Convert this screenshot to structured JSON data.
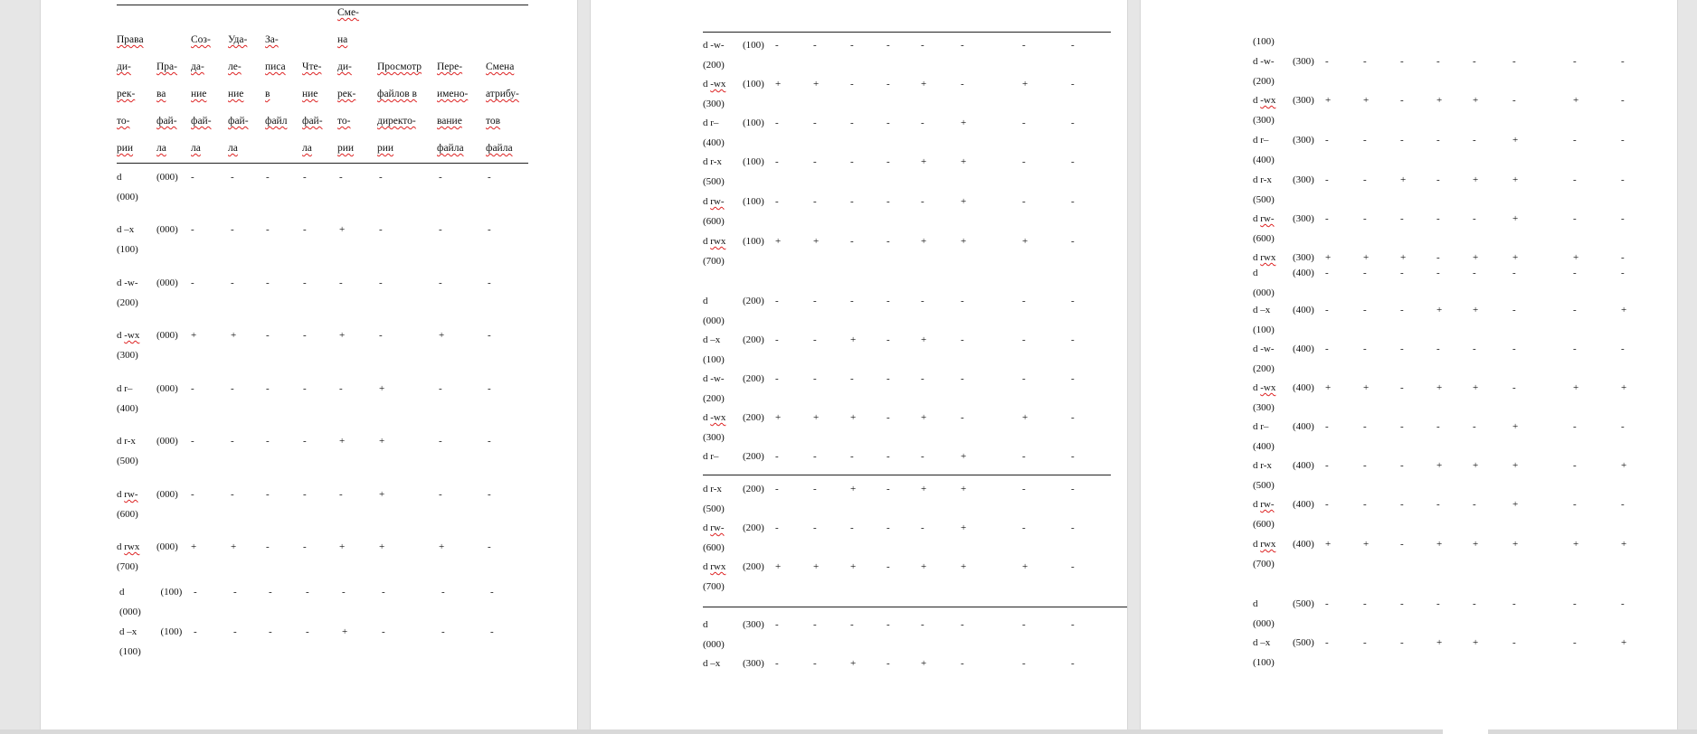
{
  "header": {
    "col1": [
      "Права",
      "ди-",
      "рек-",
      "то-",
      "рии"
    ],
    "col2": [
      "Пра-",
      "ва",
      "фай-",
      "ла"
    ],
    "col3": [
      "Соз-",
      "да-",
      "ние",
      "фай-",
      "ла"
    ],
    "col4": [
      "Уда-",
      "ле-",
      "ние",
      "фай-",
      "ла"
    ],
    "col5": [
      "За-",
      "писа",
      "в",
      "файл"
    ],
    "col6": [
      "Чте-",
      "ние",
      "фай-",
      "ла"
    ],
    "col7": [
      "Сме-",
      "на",
      "ди-",
      "рек-",
      "то-",
      "рии"
    ],
    "col8": [
      "Просмотр",
      "файлов в",
      "директо-",
      "рии"
    ],
    "col9": [
      "Пере-",
      "имено-",
      "вание",
      "файла"
    ],
    "col10": [
      "Смена",
      "атрибу-",
      "тов",
      "файла"
    ]
  },
  "page1_rows": [
    {
      "d": "d",
      "oct": "(000)",
      "file": "(000)",
      "v": [
        "-",
        "-",
        "-",
        "-",
        "-",
        "-",
        "-",
        "-"
      ]
    },
    {
      "d": "d –x",
      "oct": "(100)",
      "file": "(000)",
      "v": [
        "-",
        "-",
        "-",
        "-",
        "+",
        "-",
        "-",
        "-"
      ]
    },
    {
      "d": "d -w-",
      "oct": "(200)",
      "file": "(000)",
      "v": [
        "-",
        "-",
        "-",
        "-",
        "-",
        "-",
        "-",
        "-"
      ]
    },
    {
      "d": "d -wx",
      "oct": "(300)",
      "file": "(000)",
      "v": [
        "+",
        "+",
        "-",
        "-",
        "+",
        "-",
        "+",
        "-"
      ]
    },
    {
      "d": "d r–",
      "oct": "(400)",
      "file": "(000)",
      "v": [
        "-",
        "-",
        "-",
        "-",
        "-",
        "+",
        "-",
        "-"
      ]
    },
    {
      "d": "d r-x",
      "oct": "(500)",
      "file": "(000)",
      "v": [
        "-",
        "-",
        "-",
        "-",
        "+",
        "+",
        "-",
        "-"
      ]
    },
    {
      "d": "d rw-",
      "oct": "(600)",
      "file": "(000)",
      "v": [
        "-",
        "-",
        "-",
        "-",
        "-",
        "+",
        "-",
        "-"
      ]
    },
    {
      "d": "d rwx",
      "oct": "(700)",
      "file": "(000)",
      "v": [
        "+",
        "+",
        "-",
        "-",
        "+",
        "+",
        "+",
        "-"
      ]
    },
    {
      "d": "d",
      "oct": "(000)",
      "file": "(100)",
      "v": [
        "-",
        "-",
        "-",
        "-",
        "-",
        "-",
        "-",
        "-"
      ]
    },
    {
      "d": "d –x",
      "oct": "(100)",
      "file": "(100)",
      "v": [
        "-",
        "-",
        "-",
        "-",
        "+",
        "-",
        "-",
        "-"
      ]
    }
  ],
  "page2_rows": [
    {
      "d": "d -w-",
      "oct": "(200)",
      "file": "(100)",
      "v": [
        "-",
        "-",
        "-",
        "-",
        "-",
        "-",
        "-",
        "-"
      ]
    },
    {
      "d": "d -wx",
      "oct": "(300)",
      "file": "(100)",
      "v": [
        "+",
        "+",
        "-",
        "-",
        "+",
        "-",
        "+",
        "-"
      ]
    },
    {
      "d": "d r–",
      "oct": "(400)",
      "file": "(100)",
      "v": [
        "-",
        "-",
        "-",
        "-",
        "-",
        "+",
        "-",
        "-"
      ]
    },
    {
      "d": "d r-x",
      "oct": "(500)",
      "file": "(100)",
      "v": [
        "-",
        "-",
        "-",
        "-",
        "+",
        "+",
        "-",
        "-"
      ]
    },
    {
      "d": "d rw-",
      "oct": "(600)",
      "file": "(100)",
      "v": [
        "-",
        "-",
        "-",
        "-",
        "-",
        "+",
        "-",
        "-"
      ]
    },
    {
      "d": "d rwx",
      "oct": "(700)",
      "file": "(100)",
      "v": [
        "+",
        "+",
        "-",
        "-",
        "+",
        "+",
        "+",
        "-"
      ]
    },
    {
      "d": "d",
      "oct": "(000)",
      "file": "(200)",
      "v": [
        "-",
        "-",
        "-",
        "-",
        "-",
        "-",
        "-",
        "-"
      ]
    },
    {
      "d": "d –x",
      "oct": "(100)",
      "file": "(200)",
      "v": [
        "-",
        "-",
        "+",
        "-",
        "+",
        "-",
        "-",
        "-"
      ]
    },
    {
      "d": "d -w-",
      "oct": "(200)",
      "file": "(200)",
      "v": [
        "-",
        "-",
        "-",
        "-",
        "-",
        "-",
        "-",
        "-"
      ]
    },
    {
      "d": "d -wx",
      "oct": "(300)",
      "file": "(200)",
      "v": [
        "+",
        "+",
        "+",
        "-",
        "+",
        "-",
        "+",
        "-"
      ]
    },
    {
      "d": "d r–",
      "oct": "",
      "file": "(200)",
      "v": [
        "-",
        "-",
        "-",
        "-",
        "-",
        "+",
        "-",
        "-"
      ]
    },
    {
      "d": "d r-x",
      "oct": "(500)",
      "file": "(200)",
      "v": [
        "-",
        "-",
        "+",
        "-",
        "+",
        "+",
        "-",
        "-"
      ]
    },
    {
      "d": "d rw-",
      "oct": "(600)",
      "file": "(200)",
      "v": [
        "-",
        "-",
        "-",
        "-",
        "-",
        "+",
        "-",
        "-"
      ]
    },
    {
      "d": "d rwx",
      "oct": "(700)",
      "file": "(200)",
      "v": [
        "+",
        "+",
        "+",
        "-",
        "+",
        "+",
        "+",
        "-"
      ]
    },
    {
      "d": "d",
      "oct": "(000)",
      "file": "(300)",
      "v": [
        "-",
        "-",
        "-",
        "-",
        "-",
        "-",
        "-",
        "-"
      ]
    },
    {
      "d": "d –x",
      "oct": "",
      "file": "(300)",
      "v": [
        "-",
        "-",
        "+",
        "-",
        "+",
        "-",
        "-",
        "-"
      ]
    }
  ],
  "page3_rows": [
    {
      "d": "",
      "oct": "(100)",
      "file": "",
      "v": []
    },
    {
      "d": "d -w-",
      "oct": "(200)",
      "file": "(300)",
      "v": [
        "-",
        "-",
        "-",
        "-",
        "-",
        "-",
        "-",
        "-"
      ]
    },
    {
      "d": "d -wx",
      "oct": "(300)",
      "file": "(300)",
      "v": [
        "+",
        "+",
        "-",
        "+",
        "+",
        "-",
        "+",
        "-"
      ]
    },
    {
      "d": "d r–",
      "oct": "(400)",
      "file": "(300)",
      "v": [
        "-",
        "-",
        "-",
        "-",
        "-",
        "+",
        "-",
        "-"
      ]
    },
    {
      "d": "d r-x",
      "oct": "(500)",
      "file": "(300)",
      "v": [
        "-",
        "-",
        "+",
        "-",
        "+",
        "+",
        "-",
        "-"
      ]
    },
    {
      "d": "d rw-",
      "oct": "(600)",
      "file": "(300)",
      "v": [
        "-",
        "-",
        "-",
        "-",
        "-",
        "+",
        "-",
        "-"
      ]
    },
    {
      "d": "d rwx",
      "oct": "",
      "file": "(300)",
      "v": [
        "+",
        "+",
        "+",
        "-",
        "+",
        "+",
        "+",
        "-"
      ]
    },
    {
      "d": "d",
      "oct": "(000)",
      "file": "(400)",
      "v": [
        "-",
        "-",
        "-",
        "-",
        "-",
        "-",
        "-",
        "-"
      ]
    },
    {
      "d": "d –x",
      "oct": "(100)",
      "file": "(400)",
      "v": [
        "-",
        "-",
        "-",
        "+",
        "+",
        "-",
        "-",
        "+"
      ]
    },
    {
      "d": "d -w-",
      "oct": "(200)",
      "file": "(400)",
      "v": [
        "-",
        "-",
        "-",
        "-",
        "-",
        "-",
        "-",
        "-"
      ]
    },
    {
      "d": "d -wx",
      "oct": "(300)",
      "file": "(400)",
      "v": [
        "+",
        "+",
        "-",
        "+",
        "+",
        "-",
        "+",
        "+"
      ]
    },
    {
      "d": "d r–",
      "oct": "(400)",
      "file": "(400)",
      "v": [
        "-",
        "-",
        "-",
        "-",
        "-",
        "+",
        "-",
        "-"
      ]
    },
    {
      "d": "d r-x",
      "oct": "(500)",
      "file": "(400)",
      "v": [
        "-",
        "-",
        "-",
        "+",
        "+",
        "+",
        "-",
        "+"
      ]
    },
    {
      "d": "d rw-",
      "oct": "(600)",
      "file": "(400)",
      "v": [
        "-",
        "-",
        "-",
        "-",
        "-",
        "+",
        "-",
        "-"
      ]
    },
    {
      "d": "d rwx",
      "oct": "(700)",
      "file": "(400)",
      "v": [
        "+",
        "+",
        "-",
        "+",
        "+",
        "+",
        "+",
        "+"
      ]
    },
    {
      "d": "d",
      "oct": "(000)",
      "file": "(500)",
      "v": [
        "-",
        "-",
        "-",
        "-",
        "-",
        "-",
        "-",
        "-"
      ]
    },
    {
      "d": "d –x",
      "oct": "(100)",
      "file": "(500)",
      "v": [
        "-",
        "-",
        "-",
        "+",
        "+",
        "-",
        "-",
        "+"
      ]
    }
  ]
}
